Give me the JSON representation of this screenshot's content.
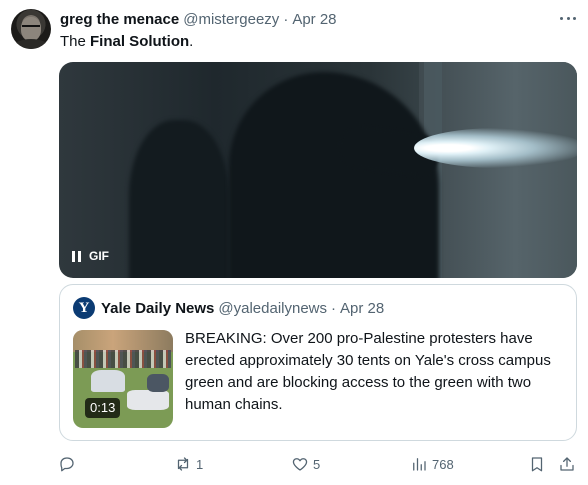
{
  "tweet": {
    "author_name": "greg the menace",
    "author_handle": "@mistergeezy",
    "separator": "·",
    "date": "Apr 28",
    "text_plain": "The ",
    "text_bold": "Final Solution",
    "text_end": ".",
    "media": {
      "badge": "GIF",
      "pause_icon": "pause-icon"
    }
  },
  "quote": {
    "logo_letter": "Y",
    "author_name": "Yale Daily News",
    "author_handle": "@yaledailynews",
    "separator": "·",
    "date": "Apr 28",
    "video_duration": "0:13",
    "text": "BREAKING: Over 200 pro-Palestine protesters have erected approximately 30 tents on Yale's cross campus green and are blocking access to the green with two human chains."
  },
  "actions": {
    "reply_icon": "reply-icon",
    "retweet_icon": "retweet-icon",
    "retweets": "1",
    "like_icon": "heart-icon",
    "likes": "5",
    "views_icon": "views-icon",
    "views": "768",
    "bookmark_icon": "bookmark-icon",
    "share_icon": "share-icon"
  },
  "colors": {
    "text": "#0f1419",
    "muted": "#536471",
    "border": "#cfd9de"
  }
}
